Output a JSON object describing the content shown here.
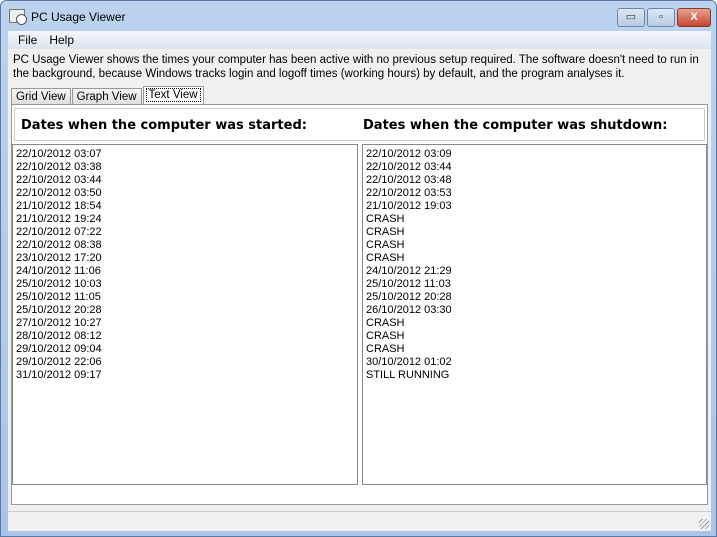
{
  "window": {
    "title": "PC Usage Viewer",
    "minimize": "▭",
    "maximize": "▫",
    "close": "X"
  },
  "menu": [
    "File",
    "Help"
  ],
  "description": "PC Usage Viewer shows the times your computer has been active with no previous setup required. The software doesn't need to run in the background, because Windows tracks login and logoff times (working hours) by default, and the program analyses it.",
  "tabs": [
    "Grid View",
    "Graph View",
    "Text View"
  ],
  "active_tab": "Text View",
  "headers": {
    "started": "Dates when the computer was started:",
    "shutdown": "Dates when the computer was shutdown:"
  },
  "started": [
    "22/10/2012 03:07",
    "22/10/2012 03:38",
    "22/10/2012 03:44",
    "22/10/2012 03:50",
    "21/10/2012 18:54",
    "21/10/2012 19:24",
    "22/10/2012 07:22",
    "22/10/2012 08:38",
    "23/10/2012 17:20",
    "24/10/2012 11:06",
    "25/10/2012 10:03",
    "25/10/2012 11:05",
    "25/10/2012 20:28",
    "27/10/2012 10:27",
    "28/10/2012 08:12",
    "29/10/2012 09:04",
    "29/10/2012 22:06",
    "31/10/2012 09:17"
  ],
  "shutdown": [
    "22/10/2012 03:09",
    "22/10/2012 03:44",
    "22/10/2012 03:48",
    "22/10/2012 03:53",
    "21/10/2012 19:03",
    "CRASH",
    "CRASH",
    "CRASH",
    "CRASH",
    "24/10/2012 21:29",
    "25/10/2012 11:03",
    "25/10/2012 20:28",
    "26/10/2012 03:30",
    "CRASH",
    "CRASH",
    "CRASH",
    "30/10/2012 01:02",
    "STILL RUNNING"
  ]
}
